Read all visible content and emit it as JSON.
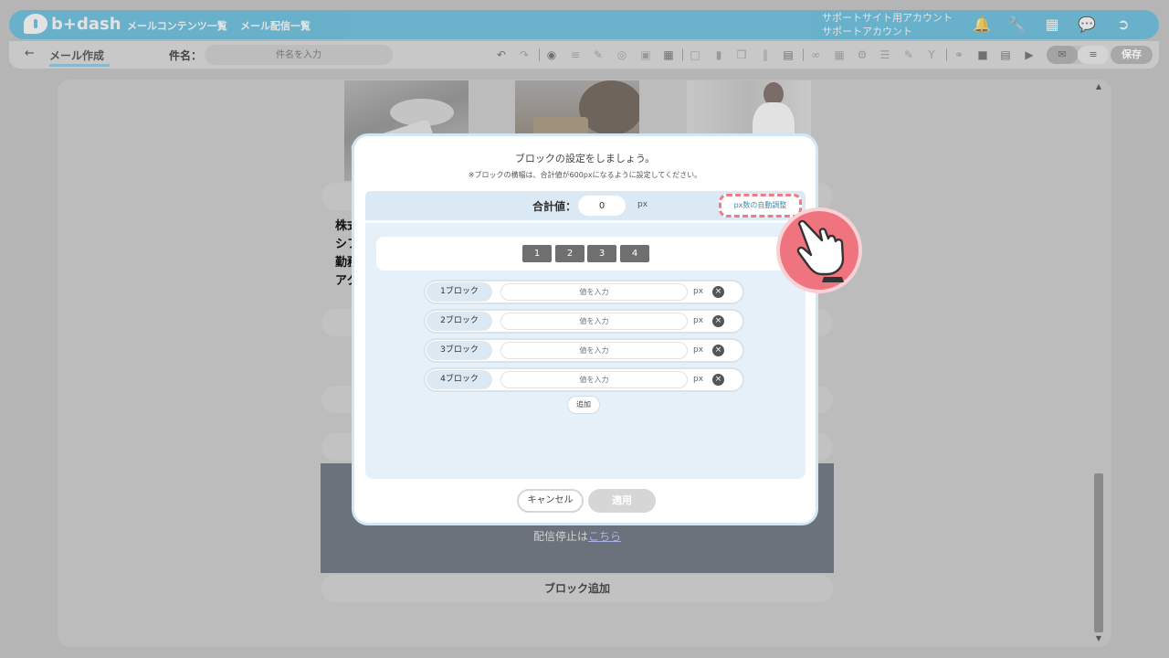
{
  "header": {
    "logo_text": "b+dash",
    "nav": [
      "メールコンテンツ一覧",
      "メール配信一覧"
    ],
    "account_line1": "サポートサイト用アカウント",
    "account_line2": "サポートアカウント",
    "icons": [
      "bell-icon",
      "wrench-icon",
      "grid-icon",
      "chat-icon",
      "logout-icon"
    ]
  },
  "toolbar": {
    "back_label": "メール作成",
    "subject_label": "件名：",
    "subject_placeholder": "件名を入力",
    "save_label": "保存"
  },
  "canvas": {
    "text_lines": [
      "株式",
      "シフ",
      "勤務",
      "アク"
    ],
    "unsubscribe_prefix": "配信停止は",
    "unsubscribe_link": "こちら",
    "add_block_label": "ブロック追加"
  },
  "modal": {
    "title": "ブロックの設定をしましょう。",
    "note": "※ブロックの横幅は、合計値が600pxになるように設定してください。",
    "total_label": "合計値：",
    "total_value": "0",
    "total_unit": "px",
    "auto_adjust_label": "px数の自動調整",
    "tabs": [
      "1",
      "2",
      "3",
      "4"
    ],
    "blocks": [
      {
        "label": "1ブロック",
        "placeholder": "値を入力",
        "unit": "px"
      },
      {
        "label": "2ブロック",
        "placeholder": "値を入力",
        "unit": "px"
      },
      {
        "label": "3ブロック",
        "placeholder": "値を入力",
        "unit": "px"
      },
      {
        "label": "4ブロック",
        "placeholder": "値を入力",
        "unit": "px"
      }
    ],
    "add_label": "追加",
    "cancel_label": "キャンセル",
    "apply_label": "適用"
  },
  "colors": {
    "header_blue": "#3cb0d9",
    "highlight_pink": "#f07a86",
    "panel_blue": "#e6f0f9"
  }
}
